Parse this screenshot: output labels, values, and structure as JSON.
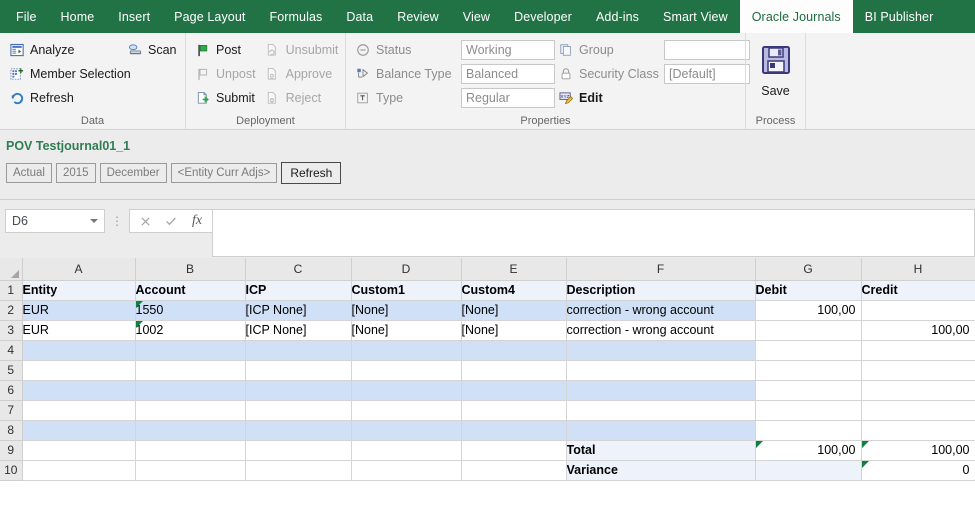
{
  "ribbon": {
    "tabs": [
      {
        "label": "File",
        "active": false
      },
      {
        "label": "Home",
        "active": false
      },
      {
        "label": "Insert",
        "active": false
      },
      {
        "label": "Page Layout",
        "active": false
      },
      {
        "label": "Formulas",
        "active": false
      },
      {
        "label": "Data",
        "active": false
      },
      {
        "label": "Review",
        "active": false
      },
      {
        "label": "View",
        "active": false
      },
      {
        "label": "Developer",
        "active": false
      },
      {
        "label": "Add-ins",
        "active": false
      },
      {
        "label": "Smart View",
        "active": false
      },
      {
        "label": "Oracle Journals",
        "active": true
      },
      {
        "label": "BI Publisher",
        "active": false
      }
    ],
    "accent_color": "#217346",
    "groups": {
      "data": {
        "label": "Data",
        "commands": [
          {
            "label": "Analyze",
            "icon": "analyze-icon",
            "enabled": true
          },
          {
            "label": "Member Selection",
            "icon": "member-selection-icon",
            "enabled": true
          },
          {
            "label": "Refresh",
            "icon": "refresh-icon",
            "enabled": true
          },
          {
            "label": "Scan",
            "icon": "scan-icon",
            "enabled": true
          }
        ]
      },
      "deployment": {
        "label": "Deployment",
        "commands": [
          {
            "label": "Post",
            "icon": "post-flag-icon",
            "enabled": true
          },
          {
            "label": "Unpost",
            "icon": "unpost-flag-icon",
            "enabled": false
          },
          {
            "label": "Submit",
            "icon": "submit-icon",
            "enabled": true
          },
          {
            "label": "Unsubmit",
            "icon": "unsubmit-icon",
            "enabled": false
          },
          {
            "label": "Approve",
            "icon": "approve-icon",
            "enabled": false
          },
          {
            "label": "Reject",
            "icon": "reject-icon",
            "enabled": false
          }
        ]
      },
      "properties": {
        "label": "Properties",
        "fields": [
          {
            "label": "Status",
            "icon": "status-icon",
            "value": "Working"
          },
          {
            "label": "Balance Type",
            "icon": "balance-type-icon",
            "value": "Balanced"
          },
          {
            "label": "Type",
            "icon": "type-icon",
            "value": "Regular"
          },
          {
            "label": "Group",
            "icon": "group-icon",
            "value": ""
          },
          {
            "label": "Security Class",
            "icon": "lock-icon",
            "value": "[Default]"
          }
        ],
        "edit_label": "Edit",
        "edit_icon": "edit-xyz-icon"
      },
      "process": {
        "label": "Process",
        "save_label": "Save",
        "save_icon": "save-floppy-icon"
      }
    }
  },
  "pov": {
    "title": "POV Testjournal01_1",
    "chips": [
      "Actual",
      "2015",
      "December",
      "<Entity Curr Adjs>"
    ],
    "refresh_label": "Refresh"
  },
  "formula_bar": {
    "name_box": "D6",
    "cancel_icon": "cancel-x-icon",
    "confirm_icon": "confirm-check-icon",
    "function_icon": "fx-icon",
    "formula_value": ""
  },
  "sheet": {
    "column_headers": [
      "A",
      "B",
      "C",
      "D",
      "E",
      "F",
      "G",
      "H"
    ],
    "row_headers": [
      "1",
      "2",
      "3",
      "4",
      "5",
      "6",
      "7",
      "8",
      "9",
      "10"
    ],
    "rows": [
      {
        "style": "hdr",
        "cells": [
          {
            "v": "Entity"
          },
          {
            "v": "Account"
          },
          {
            "v": "ICP"
          },
          {
            "v": "Custom1"
          },
          {
            "v": "Custom4"
          },
          {
            "v": "Description"
          },
          {
            "v": "Debit"
          },
          {
            "v": "Credit"
          }
        ]
      },
      {
        "style": "band",
        "cells": [
          {
            "v": "EUR"
          },
          {
            "v": "1550",
            "mark": true
          },
          {
            "v": "[ICP None]"
          },
          {
            "v": "[None]"
          },
          {
            "v": "[None]"
          },
          {
            "v": "correction - wrong account"
          },
          {
            "v": "100,00",
            "num": true,
            "style": "white"
          },
          {
            "v": "",
            "num": true,
            "style": "white"
          }
        ]
      },
      {
        "style": "plain",
        "cells": [
          {
            "v": "EUR"
          },
          {
            "v": "1002",
            "mark": true
          },
          {
            "v": "[ICP None]"
          },
          {
            "v": "[None]"
          },
          {
            "v": "[None]"
          },
          {
            "v": "correction - wrong account"
          },
          {
            "v": "",
            "num": true
          },
          {
            "v": "100,00",
            "num": true
          }
        ]
      },
      {
        "style": "band",
        "cells": [
          {
            "v": ""
          },
          {
            "v": ""
          },
          {
            "v": ""
          },
          {
            "v": ""
          },
          {
            "v": ""
          },
          {
            "v": ""
          },
          {
            "v": "",
            "style": "white"
          },
          {
            "v": "",
            "style": "white"
          }
        ]
      },
      {
        "style": "plain",
        "cells": [
          {
            "v": ""
          },
          {
            "v": ""
          },
          {
            "v": ""
          },
          {
            "v": ""
          },
          {
            "v": ""
          },
          {
            "v": ""
          },
          {
            "v": ""
          },
          {
            "v": ""
          }
        ]
      },
      {
        "style": "band",
        "cells": [
          {
            "v": ""
          },
          {
            "v": ""
          },
          {
            "v": ""
          },
          {
            "v": ""
          },
          {
            "v": ""
          },
          {
            "v": ""
          },
          {
            "v": "",
            "style": "white"
          },
          {
            "v": "",
            "style": "white"
          }
        ]
      },
      {
        "style": "plain",
        "cells": [
          {
            "v": ""
          },
          {
            "v": ""
          },
          {
            "v": ""
          },
          {
            "v": ""
          },
          {
            "v": ""
          },
          {
            "v": ""
          },
          {
            "v": ""
          },
          {
            "v": ""
          }
        ]
      },
      {
        "style": "band",
        "cells": [
          {
            "v": ""
          },
          {
            "v": ""
          },
          {
            "v": ""
          },
          {
            "v": ""
          },
          {
            "v": ""
          },
          {
            "v": ""
          },
          {
            "v": "",
            "style": "white"
          },
          {
            "v": "",
            "style": "white"
          }
        ]
      },
      {
        "style": "plain",
        "cells": [
          {
            "v": ""
          },
          {
            "v": ""
          },
          {
            "v": ""
          },
          {
            "v": ""
          },
          {
            "v": ""
          },
          {
            "v": "Total",
            "style": "tot"
          },
          {
            "v": "100,00",
            "num": true,
            "mark": true
          },
          {
            "v": "100,00",
            "num": true,
            "mark": true
          }
        ]
      },
      {
        "style": "plain",
        "cells": [
          {
            "v": ""
          },
          {
            "v": ""
          },
          {
            "v": ""
          },
          {
            "v": ""
          },
          {
            "v": ""
          },
          {
            "v": "Variance",
            "style": "tot"
          },
          {
            "v": "",
            "num": true,
            "style": "totblank"
          },
          {
            "v": "0",
            "num": true,
            "mark": true
          }
        ]
      }
    ]
  }
}
